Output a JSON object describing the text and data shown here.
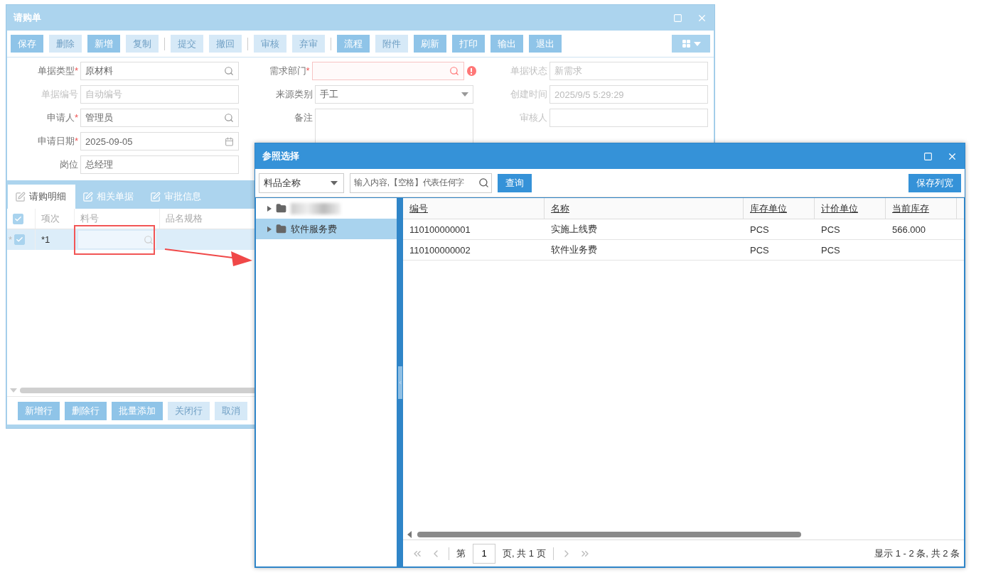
{
  "main_window": {
    "title": "请购单",
    "toolbar_groups": [
      [
        {
          "label": "保存",
          "disabled": false
        },
        {
          "label": "删除",
          "disabled": true
        },
        {
          "label": "新增",
          "disabled": false
        },
        {
          "label": "复制",
          "disabled": true
        }
      ],
      [
        {
          "label": "提交",
          "disabled": true
        },
        {
          "label": "撤回",
          "disabled": true
        }
      ],
      [
        {
          "label": "审核",
          "disabled": true
        },
        {
          "label": "弃审",
          "disabled": true
        }
      ],
      [
        {
          "label": "流程",
          "disabled": false
        },
        {
          "label": "附件",
          "disabled": true
        },
        {
          "label": "刷新",
          "disabled": false
        },
        {
          "label": "打印",
          "disabled": false
        },
        {
          "label": "输出",
          "disabled": false
        },
        {
          "label": "退出",
          "disabled": false
        }
      ]
    ],
    "form_columns": [
      [
        {
          "label": "单据类型",
          "required_mark": "*",
          "kind": "search",
          "value": "原材料",
          "disabled": false
        },
        {
          "label": "单据编号",
          "kind": "text",
          "value": "自动编号",
          "disabled": true
        },
        {
          "label": "申请人",
          "required_mark": "*",
          "kind": "search",
          "value": "管理员",
          "disabled": false
        },
        {
          "label": "申请日期",
          "required_mark": "*",
          "kind": "date",
          "value": "2025-09-05",
          "disabled": false
        },
        {
          "label": "岗位",
          "kind": "text",
          "value": "总经理",
          "disabled": false
        }
      ],
      [
        {
          "label": "需求部门",
          "required_mark": "*",
          "kind": "search",
          "disabled": false,
          "error": true
        },
        {
          "label": "来源类别",
          "kind": "select",
          "value": "手工",
          "disabled": false
        },
        {
          "label": "备注",
          "kind": "textarea",
          "disabled": false
        }
      ],
      [
        {
          "label": "单据状态",
          "kind": "text",
          "value": "新需求",
          "disabled": true
        },
        {
          "label": "创建时间",
          "kind": "text",
          "value": "2025/9/5 5:29:29",
          "disabled": true
        },
        {
          "label": "审核人",
          "kind": "text",
          "disabled": true
        }
      ]
    ],
    "tabs": [
      {
        "label": "请购明细",
        "selected": true
      },
      {
        "label": "相关单据",
        "selected": false
      },
      {
        "label": "审批信息",
        "selected": false
      }
    ],
    "grid": {
      "all_checked": true,
      "columns": [
        "项次",
        "料号",
        "品名规格"
      ],
      "rows": [
        {
          "checked": true,
          "check_marker": "*",
          "index_marker": "*",
          "index": "1"
        }
      ]
    },
    "bottom_buttons": [
      {
        "label": "新增行",
        "disabled": false
      },
      {
        "label": "删除行",
        "disabled": false
      },
      {
        "label": "批量添加",
        "disabled": false
      },
      {
        "label": "关闭行",
        "disabled": true
      },
      {
        "label": "取消",
        "disabled": true
      }
    ]
  },
  "dialog": {
    "title": "参照选择",
    "filter_select": "料品全称",
    "search_placeholder": "输入内容,【空格】代表任何字",
    "query_button": "查询",
    "save_button": "保存列宽",
    "tree": [
      {
        "kind": "redacted",
        "expanded": false,
        "selected": false
      },
      {
        "kind": "folder",
        "label": "软件服务费",
        "expanded": false,
        "selected": true
      }
    ],
    "columns": [
      "编号",
      "名称",
      "库存单位",
      "计价单位",
      "当前库存"
    ],
    "rows": [
      [
        "110100000001",
        "实施上线费",
        "PCS",
        "PCS",
        "566.000"
      ],
      [
        "110100000002",
        "软件业务费",
        "PCS",
        "PCS",
        null
      ]
    ],
    "pager": {
      "page_prefix": "第",
      "page": "1",
      "page_suffix": "页, 共 1 页",
      "summary": "显示 1 - 2 条, 共 2 条"
    }
  }
}
